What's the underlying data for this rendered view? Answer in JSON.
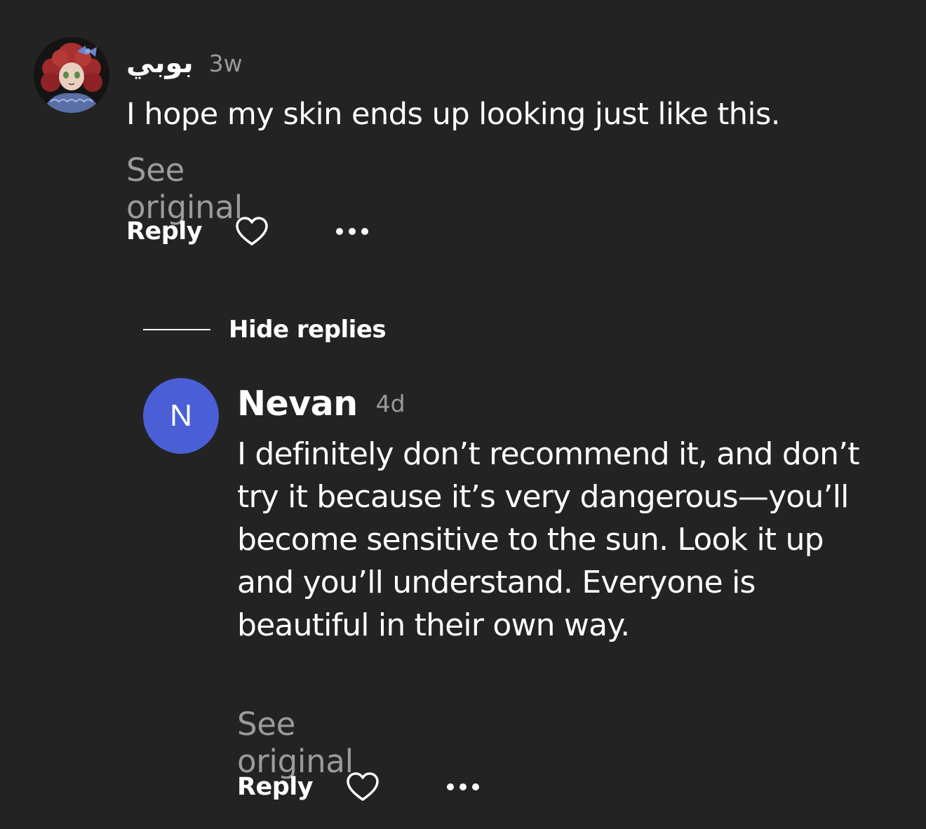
{
  "comments": [
    {
      "author": "بوبي",
      "time": "3w",
      "text": "I hope my skin ends up looking just like this.",
      "see_original": "See original",
      "reply_label": "Reply"
    },
    {
      "author": "Nevan",
      "initial": "N",
      "avatar_color": "#4a5fd6",
      "time": "4d",
      "text": "I definitely don’t recommend it, and don’t try it because it’s very dangerous—you’ll become sensitive to the sun. Look it up and you’ll understand. Everyone is beautiful in their own way.",
      "see_original": "See original",
      "reply_label": "Reply"
    }
  ],
  "replies_toggle": {
    "label": "Hide replies"
  },
  "icons": {
    "like": "heart-outline-icon",
    "more": "more-horizontal-icon"
  },
  "colors": {
    "background": "#232323",
    "primary_text": "#ffffff",
    "secondary_text": "#9b9b9b"
  }
}
